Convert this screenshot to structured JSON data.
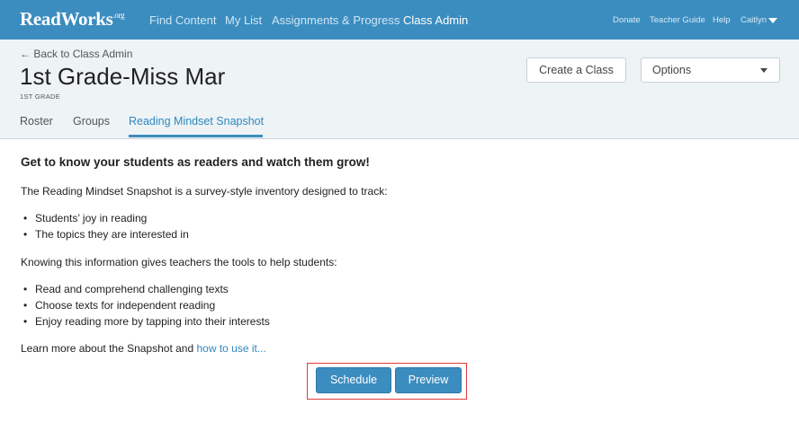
{
  "topbar": {
    "logo": "ReadWorks",
    "logo_suffix": ".org",
    "nav": [
      "Find Content",
      "My List",
      "Assignments & Progress",
      "Class Admin"
    ],
    "active_nav": "Class Admin",
    "right_links": [
      "Donate",
      "Teacher Guide",
      "Help"
    ],
    "user_name": "Caitlyn"
  },
  "header": {
    "back_link": "← Back to Class Admin",
    "class_title": "1st Grade-Miss Mar",
    "grade_caption": "1ST GRADE",
    "create_class_label": "Create a Class",
    "options_label": "Options",
    "tabs": [
      "Roster",
      "Groups",
      "Reading Mindset Snapshot"
    ],
    "active_tab": "Reading Mindset Snapshot"
  },
  "main": {
    "headline": "Get to know your students as readers and watch them grow!",
    "intro": "The Reading Mindset Snapshot is a survey-style inventory designed to track:",
    "track_items": [
      "Students’ joy in reading",
      "The topics they are interested in"
    ],
    "tools_intro": "Knowing this information gives teachers the tools to help students:",
    "tools_items": [
      "Read and comprehend challenging texts",
      "Choose texts for independent reading",
      "Enjoy reading more by tapping into their interests"
    ],
    "learn_more_prefix": "Learn more about the Snapshot and ",
    "learn_more_link": "how to use it...",
    "schedule_label": "Schedule",
    "preview_label": "Preview"
  },
  "colors": {
    "brand_blue": "#3c8dbf",
    "link_blue": "#2f87bd",
    "highlight_red": "#e03a3a",
    "header_bg": "#eef3f6"
  },
  "icons": [
    "user-menu-caret-icon",
    "options-caret-icon"
  ]
}
